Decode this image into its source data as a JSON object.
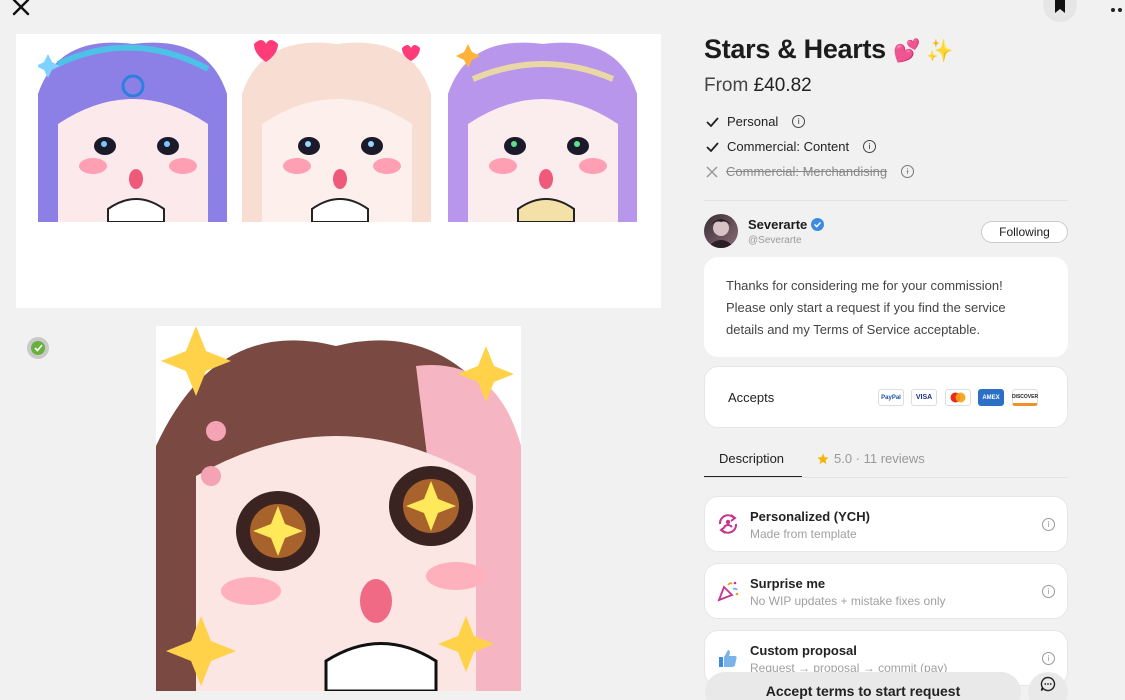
{
  "header": {
    "close_icon": "close-icon",
    "bookmark_icon": "bookmark-icon",
    "more_icon": "more-icon"
  },
  "listing": {
    "title": "Stars & Hearts",
    "title_emoji": "💕 ✨",
    "price_prefix": "From",
    "price": "£40.82"
  },
  "licenses": [
    {
      "label": "Personal",
      "enabled": true
    },
    {
      "label": "Commercial: Content",
      "enabled": true
    },
    {
      "label": "Commercial: Merchandising",
      "enabled": false
    }
  ],
  "artist": {
    "name": "Severarte",
    "handle": "@Severarte",
    "follow_label": "Following"
  },
  "note": "Thanks for considering me for your commission! Please only start a request if you find the service details and my Terms of Service acceptable.",
  "accepts": {
    "label": "Accepts",
    "methods": [
      "PayPal",
      "VISA",
      "Mastercard",
      "AMEX",
      "DISCOVER"
    ]
  },
  "tabs": {
    "description": "Description",
    "reviews": "5.0 · 11 reviews"
  },
  "options": [
    {
      "title": "Personalized (YCH)",
      "subtitle": "Made from template",
      "icon": "personalized-icon"
    },
    {
      "title": "Surprise me",
      "subtitle": "No WIP updates + mistake fixes only",
      "icon": "party-popper-icon"
    },
    {
      "title": "Custom proposal",
      "subtitle": "Request → proposal → commit (pay)",
      "icon": "thumbs-up-icon"
    }
  ],
  "cta": {
    "label": "Accept terms to start request"
  },
  "colors": {
    "accent": "#6b4fcf",
    "verified": "#3d8be0",
    "star": "#f5b400"
  }
}
